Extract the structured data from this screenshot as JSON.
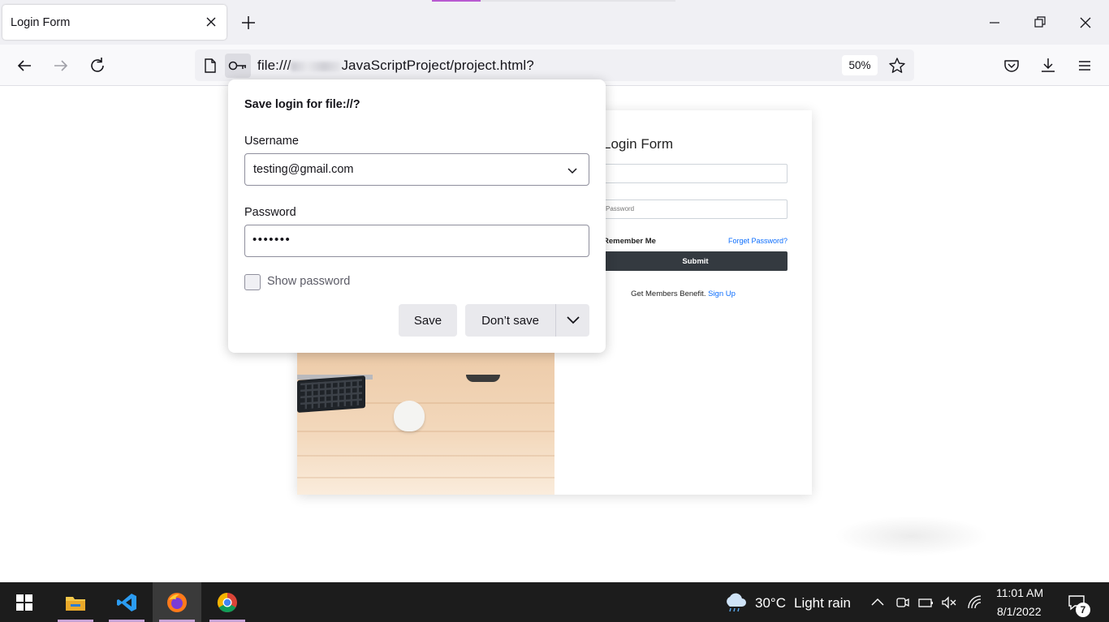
{
  "browser": {
    "tab_title": "Login Form",
    "url_prefix": "file:///",
    "url_suffix": "JavaScriptProject/project.html?",
    "zoom": "50%"
  },
  "page": {
    "form_title": "Login Form",
    "password_placeholder": "Password",
    "remember_label": "Remember Me",
    "forgot_link": "Forget Password?",
    "submit_label": "Submit",
    "members_text": "Get Members Benefit.",
    "signup_link": "Sign Up"
  },
  "popup": {
    "title": "Save login for file://?",
    "username_label": "Username",
    "username_value": "testing@gmail.com",
    "password_label": "Password",
    "password_value": "•••••••",
    "show_password_label": "Show password",
    "save_label": "Save",
    "dont_save_label": "Don’t save"
  },
  "taskbar": {
    "weather_temp": "30°C",
    "weather_desc": "Light rain",
    "time": "11:01 AM",
    "date": "8/1/2022",
    "notification_count": "7"
  }
}
